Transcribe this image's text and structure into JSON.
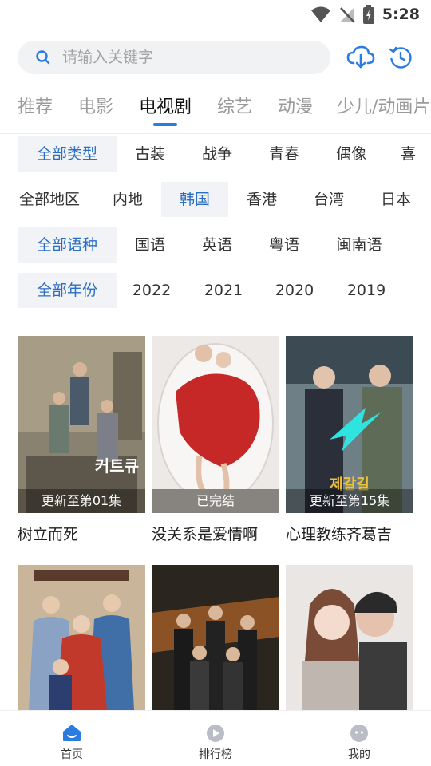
{
  "status": {
    "time": "5:28"
  },
  "search": {
    "placeholder": "请输入关键字"
  },
  "colors": {
    "accent": "#2b7be1",
    "chip_bg": "#f1f3f6"
  },
  "tabs": [
    "推荐",
    "电影",
    "电视剧",
    "综艺",
    "动漫",
    "少儿/动画片"
  ],
  "active_tab": "电视剧",
  "filters": {
    "type": [
      "全部类型",
      "古装",
      "战争",
      "青春",
      "偶像",
      "喜"
    ],
    "region": [
      "全部地区",
      "内地",
      "韩国",
      "香港",
      "台湾",
      "日本"
    ],
    "language": [
      "全部语种",
      "国语",
      "英语",
      "粤语",
      "闽南语"
    ],
    "year": [
      "全部年份",
      "2022",
      "2021",
      "2020",
      "2019"
    ]
  },
  "shows": [
    {
      "title": "树立而死",
      "badge": "更新至第01集"
    },
    {
      "title": "没关系是爱情啊",
      "badge": "已完结"
    },
    {
      "title": "心理教练齐葛吉",
      "badge": "更新至第15集"
    },
    {
      "title": "",
      "badge": ""
    },
    {
      "title": "",
      "badge": ""
    },
    {
      "title": "",
      "badge": ""
    }
  ],
  "bottom_nav": {
    "home": "首页",
    "ranking": "排行榜",
    "mine": "我的"
  }
}
